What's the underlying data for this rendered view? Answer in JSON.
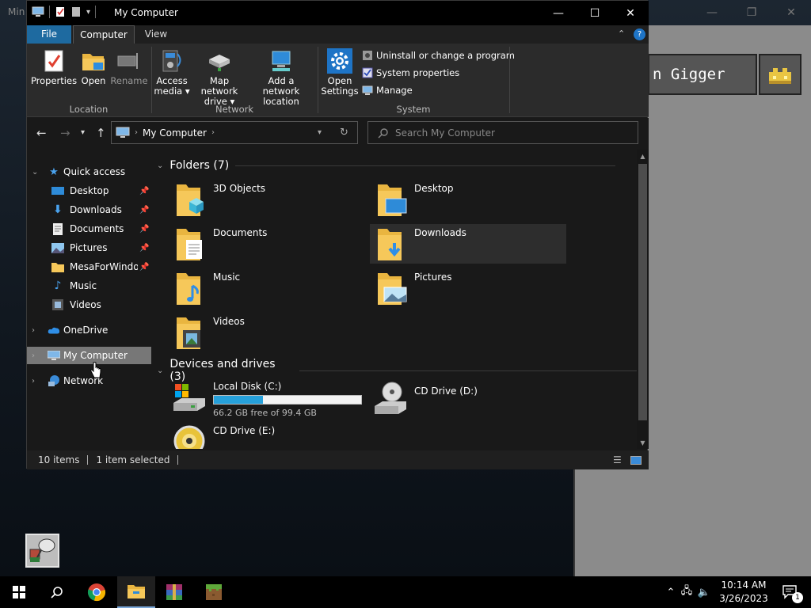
{
  "background": {
    "game_title_fragment": "Min",
    "namebox_text": "n Gigger"
  },
  "window": {
    "title": "My Computer"
  },
  "ribbon": {
    "tabs": {
      "file": "File",
      "computer": "Computer",
      "view": "View"
    },
    "location": {
      "properties": "Properties",
      "open": "Open",
      "rename": "Rename",
      "label": "Location"
    },
    "network": {
      "access_media": [
        "Access",
        "media ▾"
      ],
      "map_drive": [
        "Map network",
        "drive ▾"
      ],
      "add_location": [
        "Add a network",
        "location"
      ],
      "label": "Network"
    },
    "system": {
      "open_settings": [
        "Open",
        "Settings"
      ],
      "uninstall": "Uninstall or change a program",
      "system_properties": "System properties",
      "manage": "Manage",
      "label": "System"
    }
  },
  "address": {
    "path": "My Computer"
  },
  "search": {
    "placeholder": "Search My Computer"
  },
  "navpane": {
    "quick_access": "Quick access",
    "items": [
      {
        "label": "Desktop",
        "pinned": true
      },
      {
        "label": "Downloads",
        "pinned": true
      },
      {
        "label": "Documents",
        "pinned": true
      },
      {
        "label": "Pictures",
        "pinned": true
      },
      {
        "label": "MesaForWindows",
        "pinned": true
      },
      {
        "label": "Music",
        "pinned": false
      },
      {
        "label": "Videos",
        "pinned": false
      }
    ],
    "onedrive": "OneDrive",
    "my_computer": "My Computer",
    "network": "Network"
  },
  "content": {
    "folders_header": "Folders (7)",
    "folders": [
      "3D Objects",
      "Desktop",
      "Documents",
      "Downloads",
      "Music",
      "Pictures",
      "Videos"
    ],
    "devices_header": "Devices and drives (3)",
    "drives": {
      "c": {
        "label": "Local Disk (C:)",
        "free_text": "66.2 GB free of 99.4 GB",
        "used_fraction": 0.334
      },
      "d": {
        "label": "CD Drive (D:)"
      },
      "e": {
        "label": "CD Drive (E:)"
      }
    }
  },
  "status": {
    "count": "10 items",
    "selected": "1 item selected"
  },
  "taskbar": {
    "time": "10:14 AM",
    "date": "3/26/2023",
    "notifications": "1"
  },
  "colors": {
    "accent": "#26a0da",
    "file_tab": "#1e6aa0",
    "folder": "#f6c85a"
  }
}
